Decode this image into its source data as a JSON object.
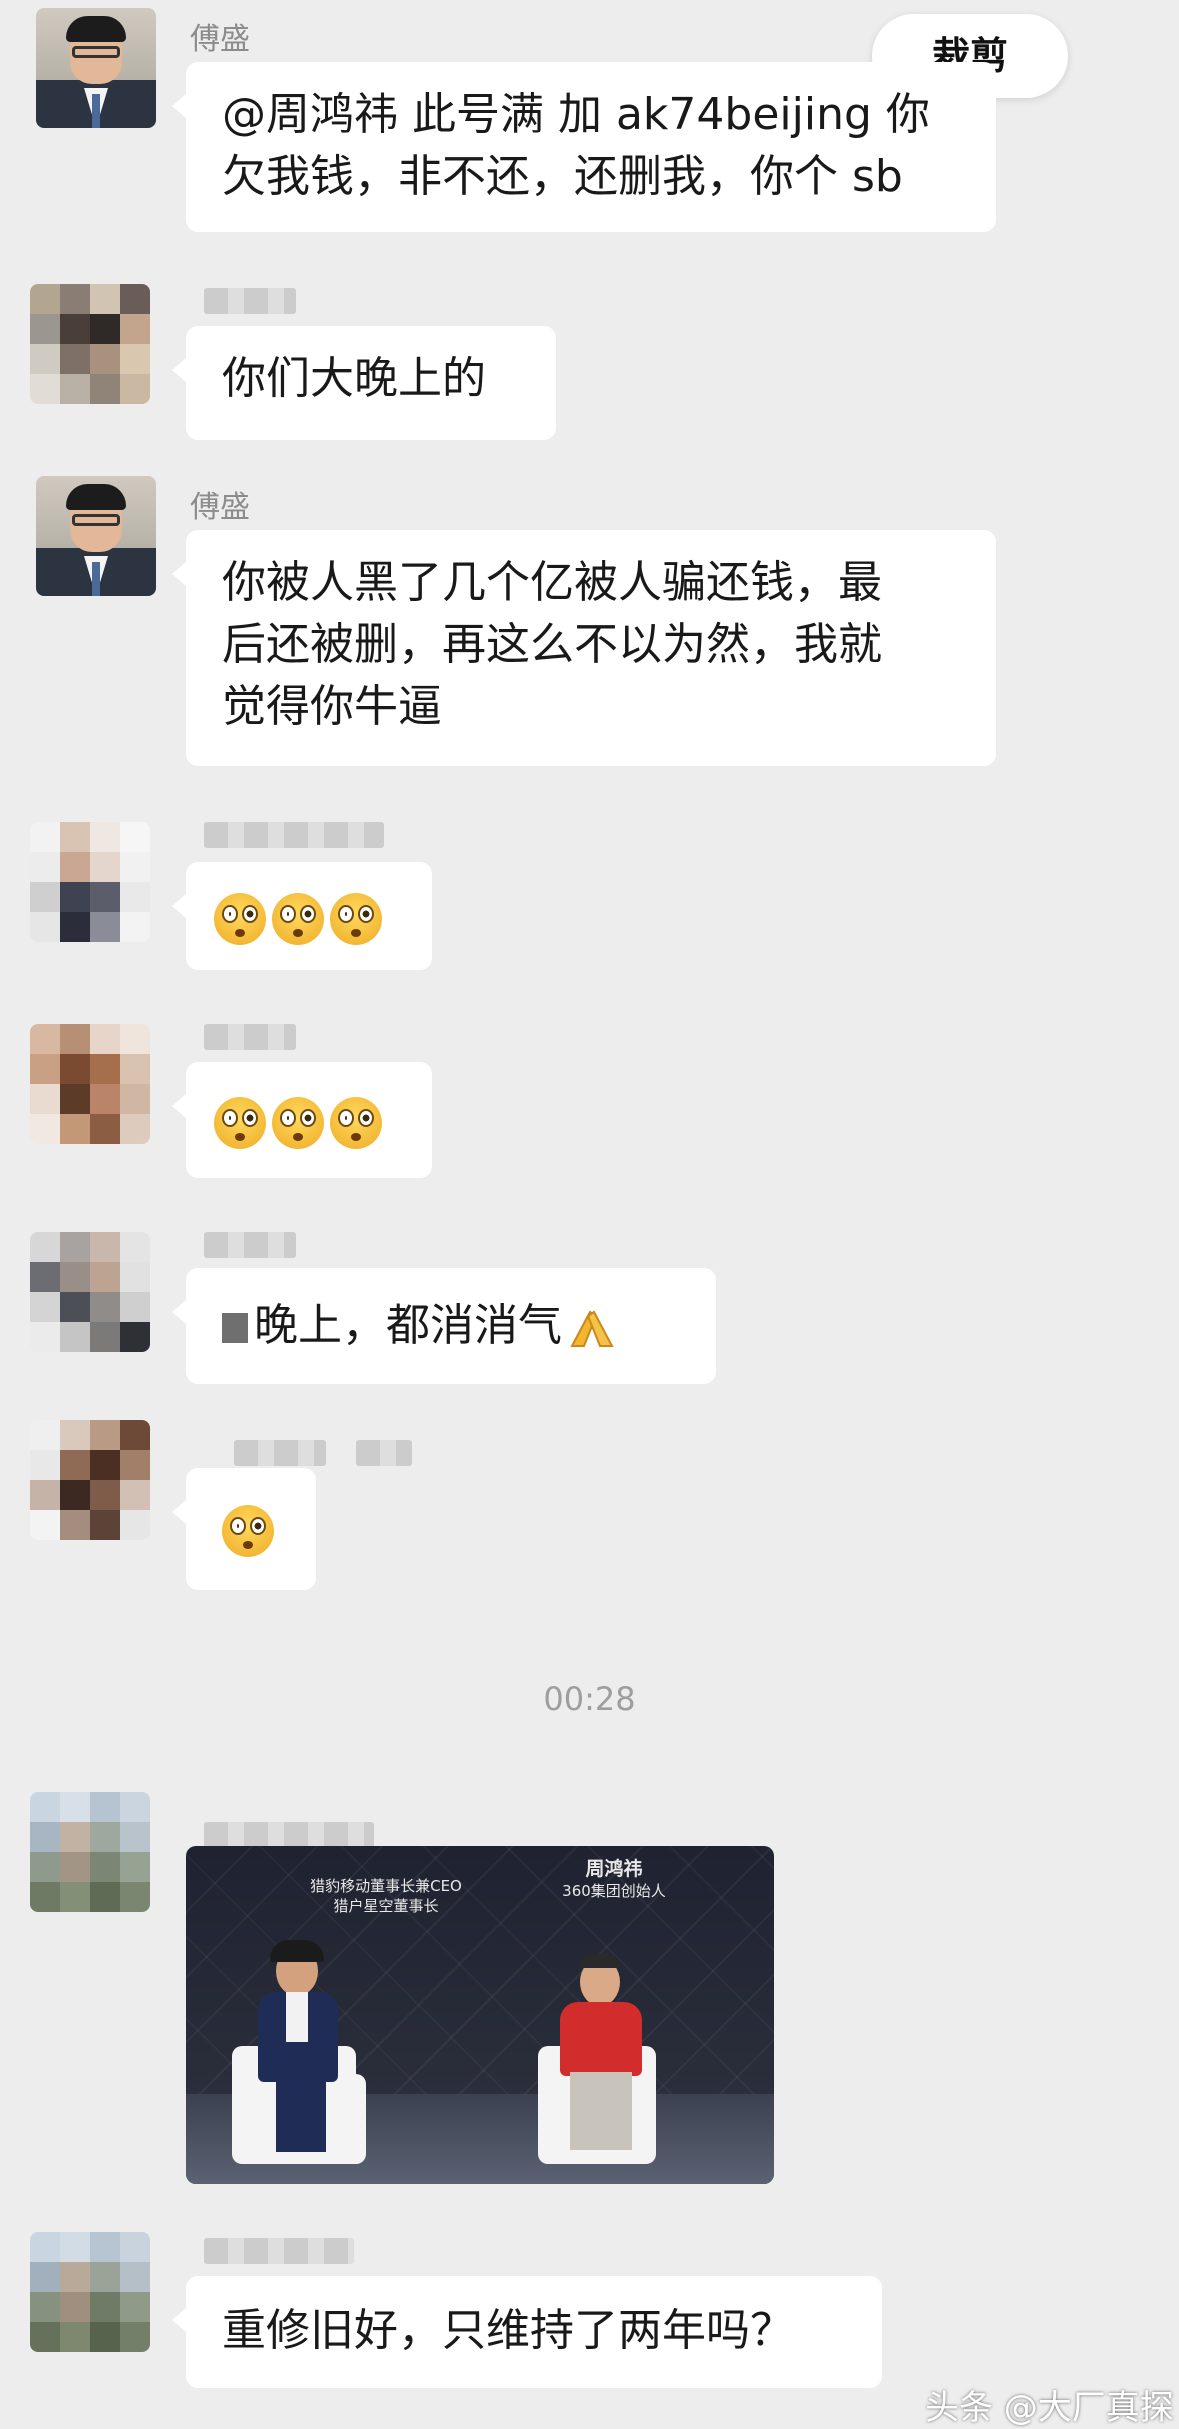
{
  "toolbar": {
    "crop_label": "裁剪"
  },
  "messages": [
    {
      "sender": "傅盛",
      "text_lines": [
        "@周鸿祎 此号满 加 ak74beijing 你",
        "欠我钱，非不还，还删我，你个 sb"
      ]
    },
    {
      "sender": "",
      "text_lines": [
        "你们大晚上的"
      ]
    },
    {
      "sender": "傅盛",
      "text_lines": [
        "你被人黑了几个亿被人骗还钱，最",
        "后还被删，再这么不以为然，我就",
        "觉得你牛逼"
      ]
    },
    {
      "sender": "",
      "emoji_count": 3,
      "emoji": "flushed-face-icon"
    },
    {
      "sender": "",
      "emoji_count": 3,
      "emoji": "flushed-face-icon"
    },
    {
      "sender": "",
      "text_lines": [
        "晚上，都消消气"
      ],
      "trailing_emoji": "praying-hands-icon"
    },
    {
      "sender": "",
      "emoji_count": 1,
      "emoji": "flushed-face-icon"
    },
    {
      "sender": "",
      "text_lines": [
        "重修旧好，只维持了两年吗？"
      ]
    }
  ],
  "timestamp": "00:28",
  "photo": {
    "left_caption_line1": "猎豹移动董事长兼CEO",
    "left_caption_line2": "猎户星空董事长",
    "right_name": "周鸿祎",
    "right_title": "360集团创始人"
  },
  "watermark": "头条 @大厂真探",
  "colors": {
    "background": "#ededed",
    "bubble": "#ffffff",
    "name": "#8c8c8c"
  }
}
